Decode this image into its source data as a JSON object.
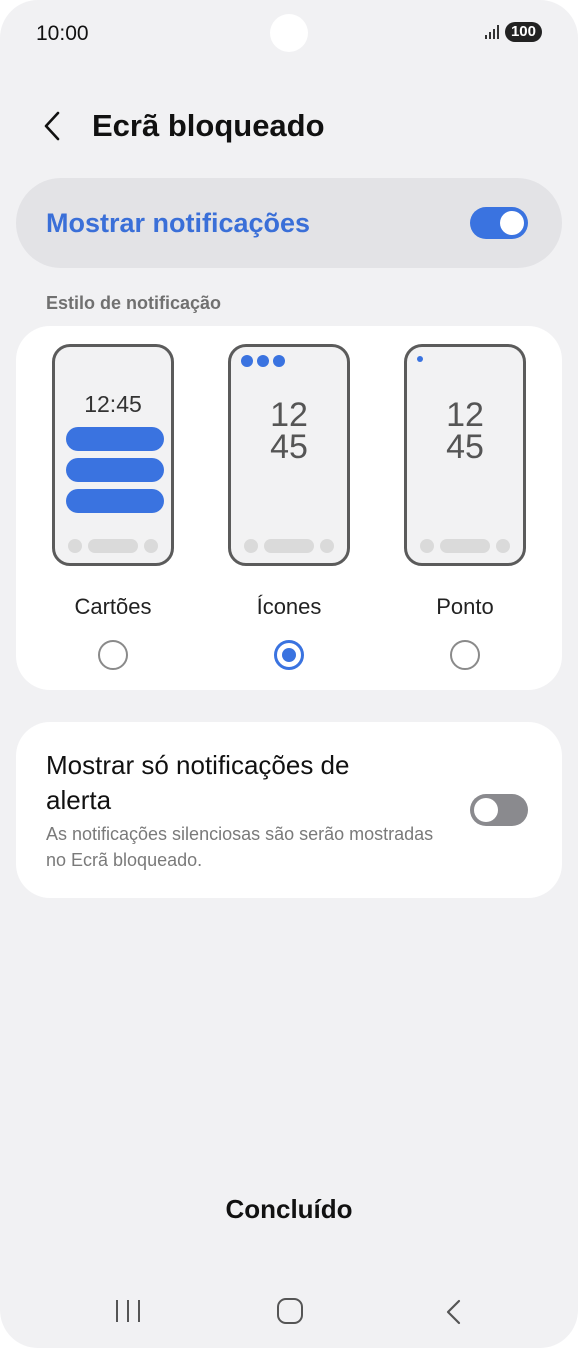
{
  "status_bar": {
    "time": "10:00",
    "battery": "100"
  },
  "header": {
    "title": "Ecrã bloqueado",
    "back_icon": "chevron-left-icon"
  },
  "master_switch": {
    "label": "Mostrar notificações",
    "enabled": true
  },
  "section": {
    "label": "Estilo de notificação"
  },
  "style_options": [
    {
      "label": "Cartões",
      "preview_time": "12:45",
      "selected": false
    },
    {
      "label": "Ícones",
      "preview_hour": "12",
      "preview_minute": "45",
      "selected": true
    },
    {
      "label": "Ponto",
      "preview_hour": "12",
      "preview_minute": "45",
      "selected": false
    }
  ],
  "alert_only": {
    "title": "Mostrar só notificações de alerta",
    "description": "As notificações silenciosas são serão mostradas no Ecrã bloqueado.",
    "enabled": false
  },
  "done_button": "Concluído",
  "colors": {
    "accent": "#3a73e0",
    "background": "#f1f1f3",
    "card": "#ffffff"
  }
}
